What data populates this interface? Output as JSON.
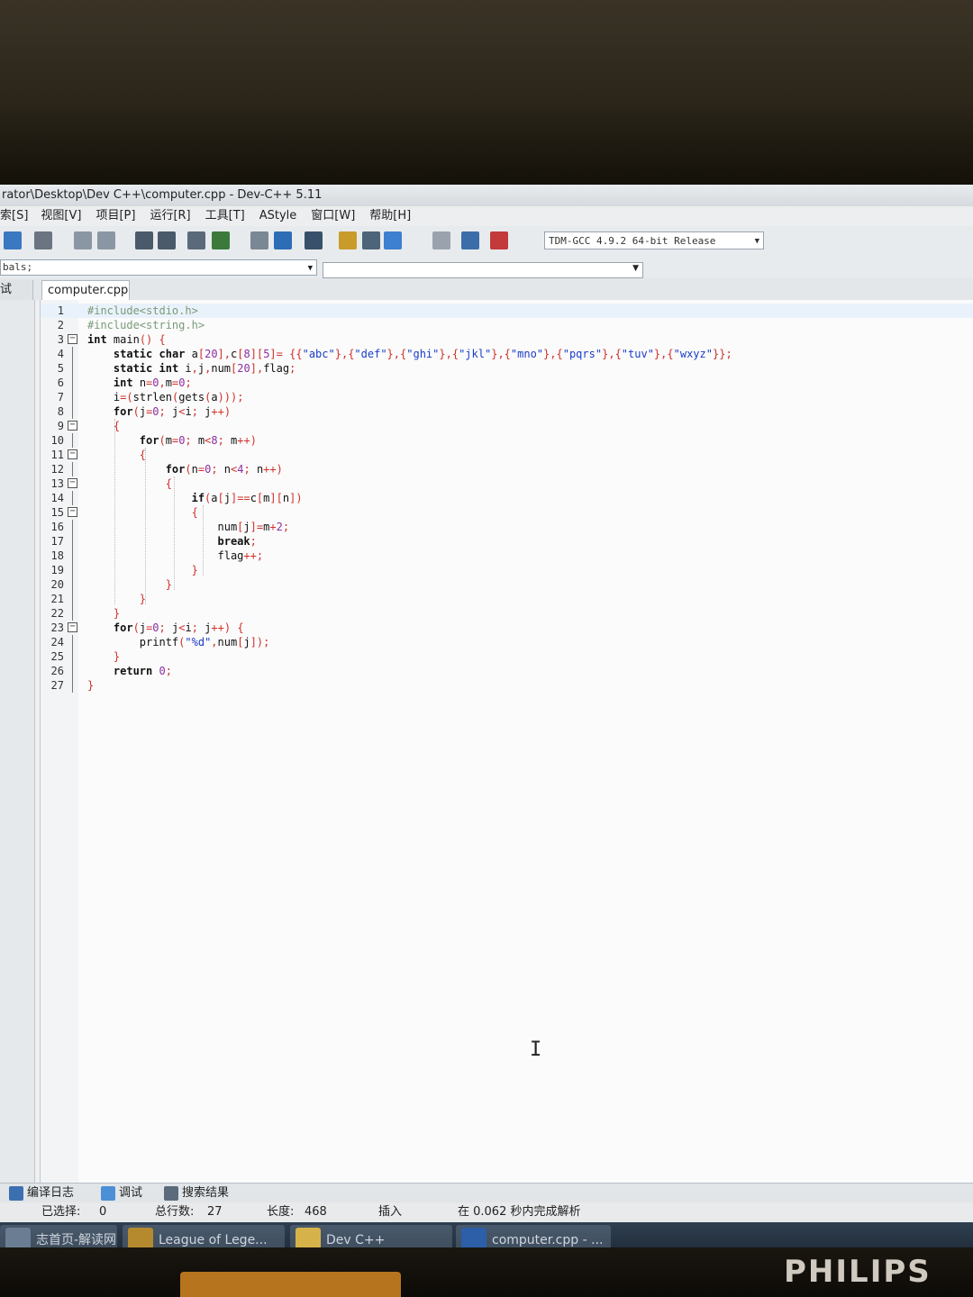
{
  "window": {
    "title": "rator\\Desktop\\Dev C++\\computer.cpp - Dev-C++ 5.11"
  },
  "menu": [
    "索[S]",
    "视图[V]",
    "项目[P]",
    "运行[R]",
    "工具[T]",
    "AStyle",
    "窗口[W]",
    "帮助[H]"
  ],
  "toolbar": {
    "compiler": "TDM-GCC 4.9.2 64-bit Release",
    "icons": [
      "new-file-icon",
      "print-icon",
      "undo-icon",
      "redo-icon",
      "find-icon",
      "replace-icon",
      "indent-icon",
      "unindent-icon",
      "bookmark-icon",
      "grid-icon",
      "window-icon",
      "layout-icon",
      "tiles-icon",
      "check-icon",
      "close-icon",
      "chart-icon",
      "profile-icon"
    ]
  },
  "class_combo": "bals;",
  "left_panel_tab": "试",
  "file_tab": "computer.cpp",
  "code": {
    "lines": [
      {
        "n": "1",
        "fold": "",
        "text": "#include<stdio.h>"
      },
      {
        "n": "2",
        "fold": "",
        "text": "#include<string.h>"
      },
      {
        "n": "3",
        "fold": "-",
        "text": "int main() {"
      },
      {
        "n": "4",
        "fold": "",
        "text": "    static char a[20],c[8][5]= {{\"abc\"},{\"def\"},{\"ghi\"},{\"jkl\"},{\"mno\"},{\"pqrs\"},{\"tuv\"},{\"wxyz\"}};"
      },
      {
        "n": "5",
        "fold": "",
        "text": "    static int i,j,num[20],flag;"
      },
      {
        "n": "6",
        "fold": "",
        "text": "    int n=0,m=0;"
      },
      {
        "n": "7",
        "fold": "",
        "text": "    i=(strlen(gets(a)));"
      },
      {
        "n": "8",
        "fold": "",
        "text": "    for(j=0; j<i; j++)"
      },
      {
        "n": "9",
        "fold": "-",
        "text": "    {"
      },
      {
        "n": "10",
        "fold": "",
        "text": "        for(m=0; m<8; m++)"
      },
      {
        "n": "11",
        "fold": "-",
        "text": "        {"
      },
      {
        "n": "12",
        "fold": "",
        "text": "            for(n=0; n<4; n++)"
      },
      {
        "n": "13",
        "fold": "-",
        "text": "            {"
      },
      {
        "n": "14",
        "fold": "",
        "text": "                if(a[j]==c[m][n])"
      },
      {
        "n": "15",
        "fold": "-",
        "text": "                {"
      },
      {
        "n": "16",
        "fold": "",
        "text": "                    num[j]=m+2;"
      },
      {
        "n": "17",
        "fold": "",
        "text": "                    break;"
      },
      {
        "n": "18",
        "fold": "",
        "text": "                    flag++;"
      },
      {
        "n": "19",
        "fold": "",
        "text": "                }"
      },
      {
        "n": "20",
        "fold": "",
        "text": "            }"
      },
      {
        "n": "21",
        "fold": "",
        "text": "        }"
      },
      {
        "n": "22",
        "fold": "",
        "text": "    }"
      },
      {
        "n": "23",
        "fold": "-",
        "text": "    for(j=0; j<i; j++) {"
      },
      {
        "n": "24",
        "fold": "",
        "text": "        printf(\"%d\",num[j]);"
      },
      {
        "n": "25",
        "fold": "",
        "text": "    }"
      },
      {
        "n": "26",
        "fold": "",
        "text": "    return 0;"
      },
      {
        "n": "27",
        "fold": "",
        "text": "}"
      }
    ]
  },
  "bottom_tabs": [
    "编译日志",
    "调试",
    "搜索结果"
  ],
  "status": {
    "selected_label": "已选择:",
    "selected_value": "0",
    "total_lines_label": "总行数:",
    "total_lines_value": "27",
    "length_label": "长度:",
    "length_value": "468",
    "mode": "插入",
    "parse_msg": "在 0.062 秒内完成解析"
  },
  "taskbar": [
    {
      "label": "志首页-解读网",
      "color": "#6a7d92"
    },
    {
      "label": "League of Lege...",
      "color": "#b58a2e"
    },
    {
      "label": "Dev C++",
      "color": "#d6b24a"
    },
    {
      "label": "computer.cpp - ...",
      "color": "#2c5fa8"
    }
  ],
  "monitor_brand": "PHILIPS"
}
